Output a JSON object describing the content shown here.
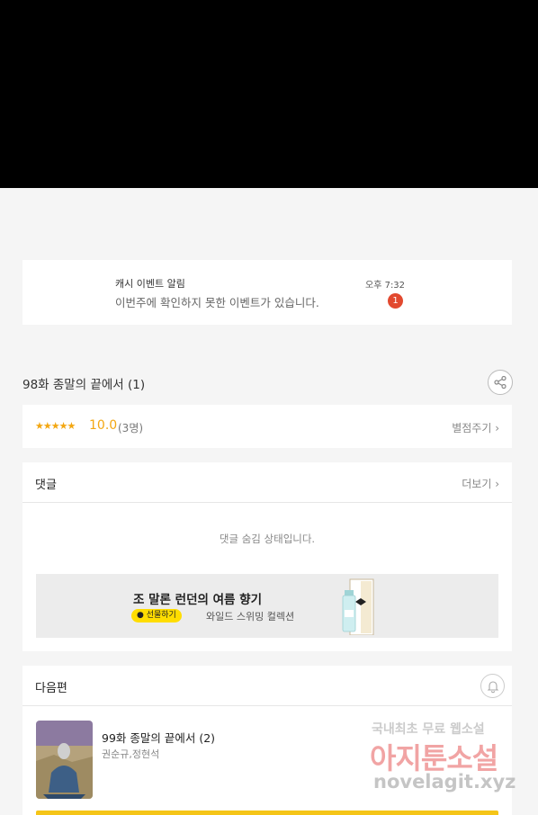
{
  "notification": {
    "title": "캐시 이벤트 알림",
    "body": "이번주에 확인하지 못한 이벤트가 있습니다.",
    "time": "오후 7:32",
    "badge": "1"
  },
  "episode": {
    "title": "98화 종말의 끝에서 (1)",
    "share_icon": "share-icon"
  },
  "rating": {
    "stars": "★★★★★",
    "score": "10.0",
    "count": "(3명)",
    "rate_link": "별점주기 ›"
  },
  "comments": {
    "title": "댓글",
    "more_link": "더보기 ›",
    "hidden_message": "댓글 숨김 상태입니다."
  },
  "ad": {
    "headline": "조 말론 런던의 여름 향기",
    "pill": "● 선물하기",
    "subline": "와일드 스위밍 컬렉션"
  },
  "next_episode": {
    "section_title": "다음편",
    "bell_icon": "bell-icon",
    "title": "99화 종말의 끝에서 (2)",
    "authors": "권순규,정현석"
  },
  "watermark": {
    "line1": "국내최초 무료 웹소설",
    "line2": "아지툰소설",
    "line3": "novelagit.xyz"
  },
  "colors": {
    "accent_star": "#f3a712",
    "badge": "#e2492f",
    "pill": "#ffdd00",
    "bottom_bar": "#f5c518"
  }
}
